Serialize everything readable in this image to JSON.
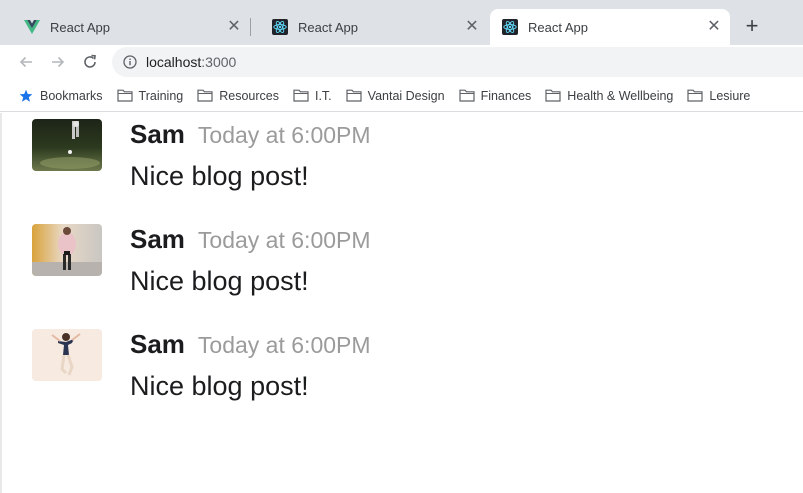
{
  "browser": {
    "tabs": [
      {
        "title": "React App",
        "favicon": "vue-logo-icon",
        "active": false
      },
      {
        "title": "React App",
        "favicon": "react-logo-icon",
        "active": false
      },
      {
        "title": "React App",
        "favicon": "react-logo-icon",
        "active": true
      }
    ],
    "close_glyph": "✕",
    "new_tab_glyph": "+",
    "address": {
      "host": "localhost",
      "port": ":3000"
    },
    "bookmarks": [
      {
        "label": "Bookmarks",
        "icon": "star-icon"
      },
      {
        "label": "Training",
        "icon": "folder-icon"
      },
      {
        "label": "Resources",
        "icon": "folder-icon"
      },
      {
        "label": "I.T.",
        "icon": "folder-icon"
      },
      {
        "label": "Vantai Design",
        "icon": "folder-icon"
      },
      {
        "label": "Finances",
        "icon": "folder-icon"
      },
      {
        "label": "Health & Wellbeing",
        "icon": "folder-icon"
      },
      {
        "label": "Lesiure",
        "icon": "folder-icon"
      }
    ]
  },
  "comments": [
    {
      "author": "Sam",
      "date": "Today at 6:00PM",
      "text": "Nice blog post!",
      "avatar": "night-photo-avatar"
    },
    {
      "author": "Sam",
      "date": "Today at 6:00PM",
      "text": "Nice blog post!",
      "avatar": "fashion-photo-avatar"
    },
    {
      "author": "Sam",
      "date": "Today at 6:00PM",
      "text": "Nice blog post!",
      "avatar": "dancer-photo-avatar"
    }
  ],
  "colors": {
    "tabstrip": "#dee1e6",
    "omnibox": "#f1f3f4",
    "bookmark_star": "#1a73e8",
    "author_text": "#1b1c1d",
    "date_text": "#9b9b9b"
  }
}
